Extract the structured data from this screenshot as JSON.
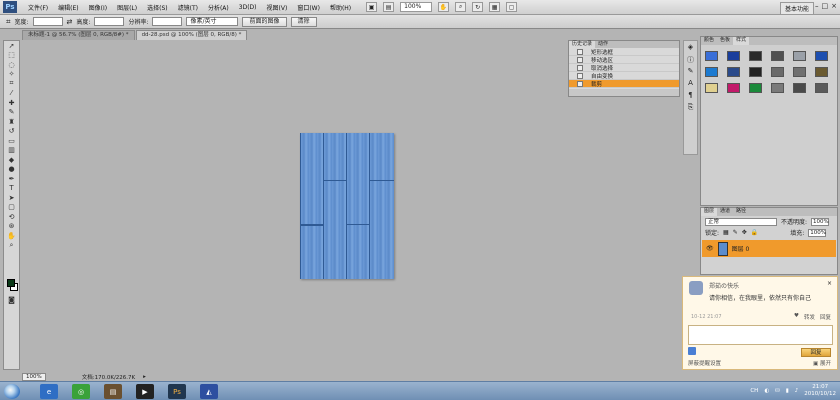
{
  "menubar": {
    "logo": "Ps",
    "items": [
      "文件(F)",
      "编辑(E)",
      "图像(I)",
      "图层(L)",
      "选择(S)",
      "滤镜(T)",
      "分析(A)",
      "3D(D)",
      "视图(V)",
      "窗口(W)",
      "帮助(H)"
    ],
    "zoom": "100%",
    "workspace": "基本功能"
  },
  "options": {
    "width_label": "宽度:",
    "height_label": "高度:",
    "resolution_label": "分辨率:",
    "unit": "像素/英寸",
    "front_image": "前面的图像",
    "clear": "清除"
  },
  "tabs": [
    {
      "label": "未标题-1 @ 56.7% (图层 0, RGB/8#) *"
    },
    {
      "label": "dd-28.psd @ 100% (图层 0, RGB/8) *"
    }
  ],
  "status": {
    "zoom": "100%",
    "doc": "文档:170.0K/226.7K"
  },
  "history": {
    "tabs": [
      "历史记录",
      "动作"
    ],
    "items": [
      "矩形选框",
      "移动选区",
      "取消选择",
      "自由变换",
      "裁剪"
    ],
    "selected_index": 4
  },
  "styles_panel": {
    "tabs": [
      "颜色",
      "色板",
      "样式"
    ],
    "swatches": [
      "#3a6fd8",
      "#1a3e9c",
      "#2a2a2a",
      "#505050",
      "#9aa0a8",
      "#1d4fb0",
      "#1c7ad0",
      "#2a4a8a",
      "#222",
      "#6a6a6a",
      "#707070",
      "#6a5a30",
      "#e0d090",
      "#c21a6a",
      "#1a8a3a",
      "#7a7a7a",
      "#4a4a4a",
      "#5a5a5a"
    ]
  },
  "layers": {
    "tabs": [
      "图层",
      "通道",
      "路径"
    ],
    "mode": "正常",
    "opacity_label": "不透明度:",
    "opacity": "100%",
    "lock_label": "锁定:",
    "fill_label": "填充:",
    "fill": "100%",
    "layer_name": "图层 0"
  },
  "qq": {
    "name": "郑茹の快乐",
    "message_pre": "请你相信，在我眼里，依然只有你自己",
    "date": "10-12 21:07",
    "actions": [
      "转发",
      "回复"
    ],
    "send": "回复",
    "footer": "屏蔽提醒设置",
    "expand": "展开"
  },
  "taskbar": {
    "time": "21:07",
    "date": "2010/10/12",
    "lang": "CH"
  }
}
